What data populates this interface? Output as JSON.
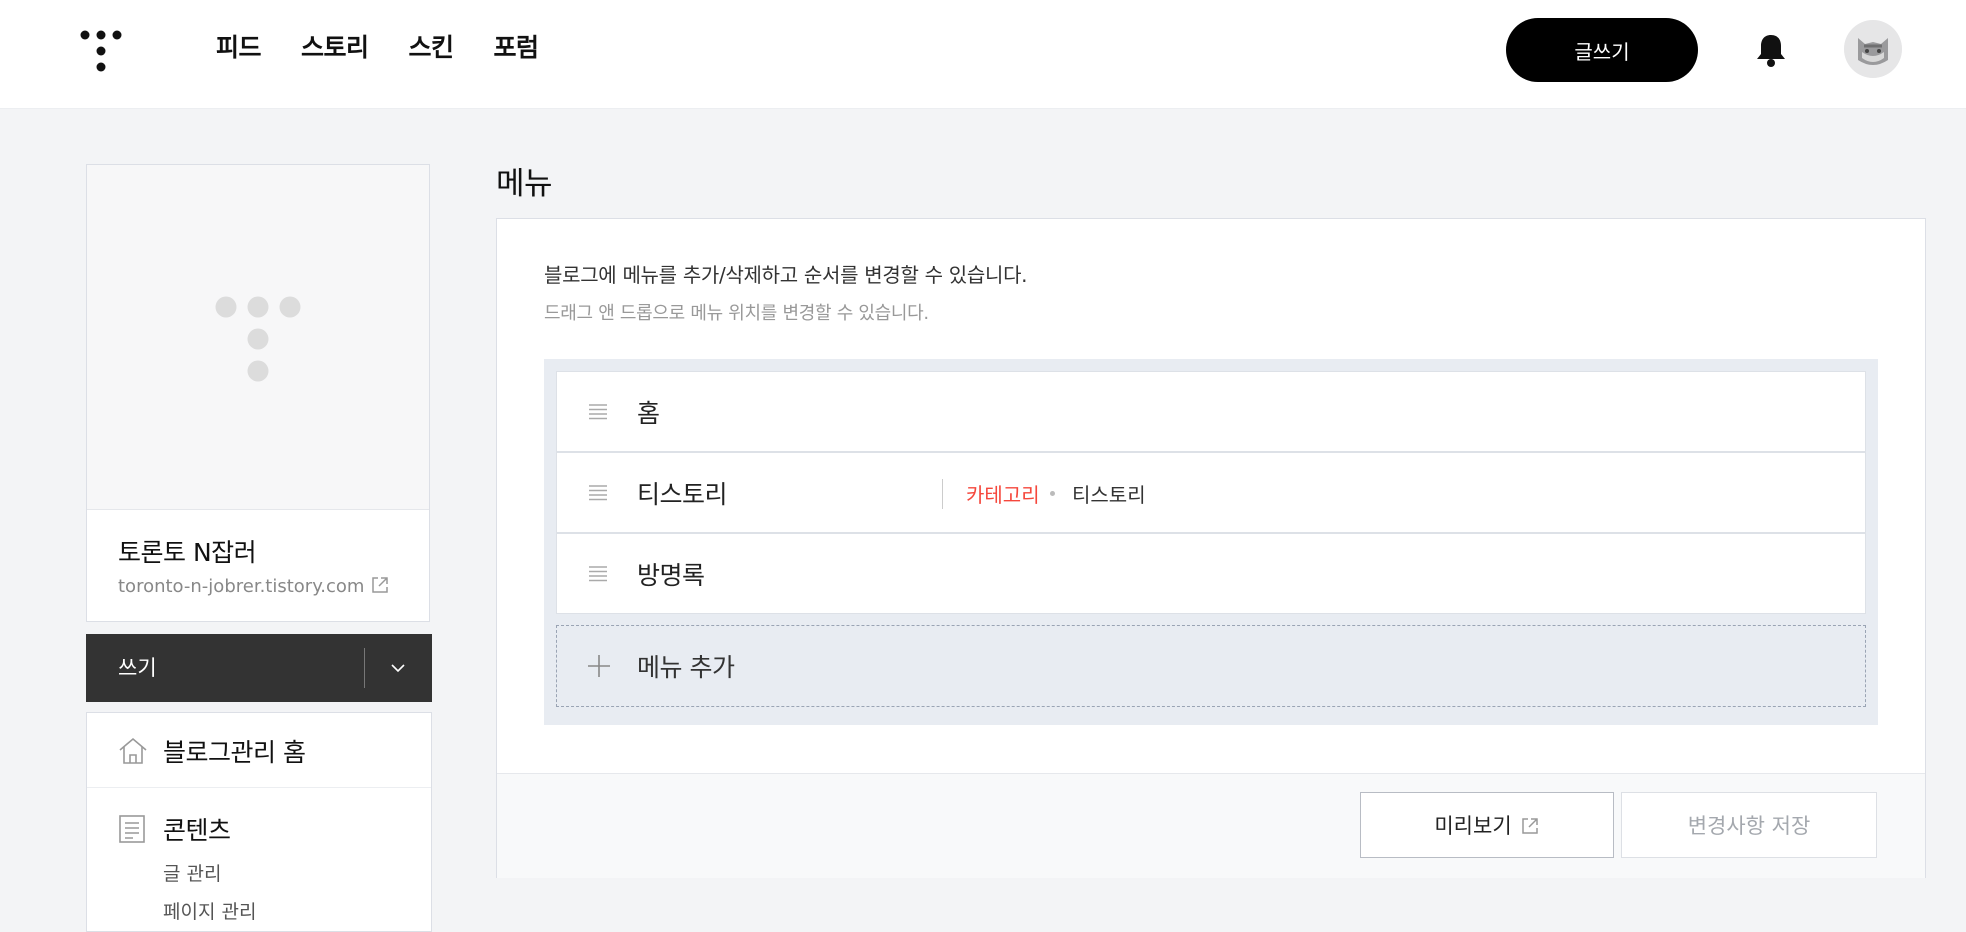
{
  "header": {
    "logo": "tistory-logo-icon",
    "nav": [
      {
        "label": "피드"
      },
      {
        "label": "스토리"
      },
      {
        "label": "스킨"
      },
      {
        "label": "포럼"
      }
    ],
    "write_label": "글쓰기",
    "bell": "bell-icon",
    "avatar": "profile-avatar"
  },
  "sidebar": {
    "blog_name": "토론토 N잡러",
    "blog_url": "toronto-n-jobrer.tistory.com",
    "write_dropdown_label": "쓰기",
    "menu": {
      "home_label": "블로그관리 홈",
      "content_label": "콘텐츠",
      "content_sub": [
        "글 관리",
        "페이지 관리"
      ]
    }
  },
  "main": {
    "title": "메뉴",
    "description": "블로그에 메뉴를 추가/삭제하고 순서를 변경할 수 있습니다.",
    "hint": "드래그 앤 드롭으로 메뉴 위치를 변경할 수 있습니다.",
    "menu_items": [
      {
        "label": "홈"
      },
      {
        "label": "티스토리",
        "type_label": "카테고리",
        "value": "티스토리"
      },
      {
        "label": "방명록"
      }
    ],
    "add_label": "메뉴 추가",
    "preview_label": "미리보기",
    "save_label": "변경사항 저장"
  },
  "colors": {
    "accent_red": "#f5473c",
    "primary_black": "#000000"
  }
}
